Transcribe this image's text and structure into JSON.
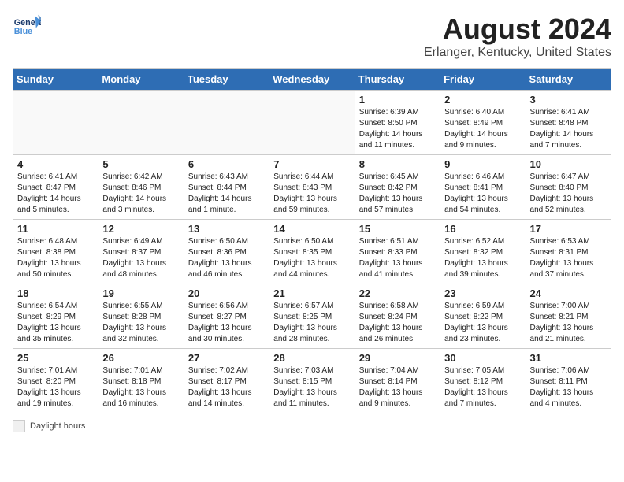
{
  "header": {
    "logo_general": "General",
    "logo_blue": "Blue",
    "title": "August 2024",
    "subtitle": "Erlanger, Kentucky, United States"
  },
  "calendar": {
    "days_of_week": [
      "Sunday",
      "Monday",
      "Tuesday",
      "Wednesday",
      "Thursday",
      "Friday",
      "Saturday"
    ],
    "weeks": [
      [
        {
          "day": "",
          "info": ""
        },
        {
          "day": "",
          "info": ""
        },
        {
          "day": "",
          "info": ""
        },
        {
          "day": "",
          "info": ""
        },
        {
          "day": "1",
          "info": "Sunrise: 6:39 AM\nSunset: 8:50 PM\nDaylight: 14 hours and 11 minutes."
        },
        {
          "day": "2",
          "info": "Sunrise: 6:40 AM\nSunset: 8:49 PM\nDaylight: 14 hours and 9 minutes."
        },
        {
          "day": "3",
          "info": "Sunrise: 6:41 AM\nSunset: 8:48 PM\nDaylight: 14 hours and 7 minutes."
        }
      ],
      [
        {
          "day": "4",
          "info": "Sunrise: 6:41 AM\nSunset: 8:47 PM\nDaylight: 14 hours and 5 minutes."
        },
        {
          "day": "5",
          "info": "Sunrise: 6:42 AM\nSunset: 8:46 PM\nDaylight: 14 hours and 3 minutes."
        },
        {
          "day": "6",
          "info": "Sunrise: 6:43 AM\nSunset: 8:44 PM\nDaylight: 14 hours and 1 minute."
        },
        {
          "day": "7",
          "info": "Sunrise: 6:44 AM\nSunset: 8:43 PM\nDaylight: 13 hours and 59 minutes."
        },
        {
          "day": "8",
          "info": "Sunrise: 6:45 AM\nSunset: 8:42 PM\nDaylight: 13 hours and 57 minutes."
        },
        {
          "day": "9",
          "info": "Sunrise: 6:46 AM\nSunset: 8:41 PM\nDaylight: 13 hours and 54 minutes."
        },
        {
          "day": "10",
          "info": "Sunrise: 6:47 AM\nSunset: 8:40 PM\nDaylight: 13 hours and 52 minutes."
        }
      ],
      [
        {
          "day": "11",
          "info": "Sunrise: 6:48 AM\nSunset: 8:38 PM\nDaylight: 13 hours and 50 minutes."
        },
        {
          "day": "12",
          "info": "Sunrise: 6:49 AM\nSunset: 8:37 PM\nDaylight: 13 hours and 48 minutes."
        },
        {
          "day": "13",
          "info": "Sunrise: 6:50 AM\nSunset: 8:36 PM\nDaylight: 13 hours and 46 minutes."
        },
        {
          "day": "14",
          "info": "Sunrise: 6:50 AM\nSunset: 8:35 PM\nDaylight: 13 hours and 44 minutes."
        },
        {
          "day": "15",
          "info": "Sunrise: 6:51 AM\nSunset: 8:33 PM\nDaylight: 13 hours and 41 minutes."
        },
        {
          "day": "16",
          "info": "Sunrise: 6:52 AM\nSunset: 8:32 PM\nDaylight: 13 hours and 39 minutes."
        },
        {
          "day": "17",
          "info": "Sunrise: 6:53 AM\nSunset: 8:31 PM\nDaylight: 13 hours and 37 minutes."
        }
      ],
      [
        {
          "day": "18",
          "info": "Sunrise: 6:54 AM\nSunset: 8:29 PM\nDaylight: 13 hours and 35 minutes."
        },
        {
          "day": "19",
          "info": "Sunrise: 6:55 AM\nSunset: 8:28 PM\nDaylight: 13 hours and 32 minutes."
        },
        {
          "day": "20",
          "info": "Sunrise: 6:56 AM\nSunset: 8:27 PM\nDaylight: 13 hours and 30 minutes."
        },
        {
          "day": "21",
          "info": "Sunrise: 6:57 AM\nSunset: 8:25 PM\nDaylight: 13 hours and 28 minutes."
        },
        {
          "day": "22",
          "info": "Sunrise: 6:58 AM\nSunset: 8:24 PM\nDaylight: 13 hours and 26 minutes."
        },
        {
          "day": "23",
          "info": "Sunrise: 6:59 AM\nSunset: 8:22 PM\nDaylight: 13 hours and 23 minutes."
        },
        {
          "day": "24",
          "info": "Sunrise: 7:00 AM\nSunset: 8:21 PM\nDaylight: 13 hours and 21 minutes."
        }
      ],
      [
        {
          "day": "25",
          "info": "Sunrise: 7:01 AM\nSunset: 8:20 PM\nDaylight: 13 hours and 19 minutes."
        },
        {
          "day": "26",
          "info": "Sunrise: 7:01 AM\nSunset: 8:18 PM\nDaylight: 13 hours and 16 minutes."
        },
        {
          "day": "27",
          "info": "Sunrise: 7:02 AM\nSunset: 8:17 PM\nDaylight: 13 hours and 14 minutes."
        },
        {
          "day": "28",
          "info": "Sunrise: 7:03 AM\nSunset: 8:15 PM\nDaylight: 13 hours and 11 minutes."
        },
        {
          "day": "29",
          "info": "Sunrise: 7:04 AM\nSunset: 8:14 PM\nDaylight: 13 hours and 9 minutes."
        },
        {
          "day": "30",
          "info": "Sunrise: 7:05 AM\nSunset: 8:12 PM\nDaylight: 13 hours and 7 minutes."
        },
        {
          "day": "31",
          "info": "Sunrise: 7:06 AM\nSunset: 8:11 PM\nDaylight: 13 hours and 4 minutes."
        }
      ]
    ]
  },
  "legend": {
    "label": "Daylight hours"
  }
}
